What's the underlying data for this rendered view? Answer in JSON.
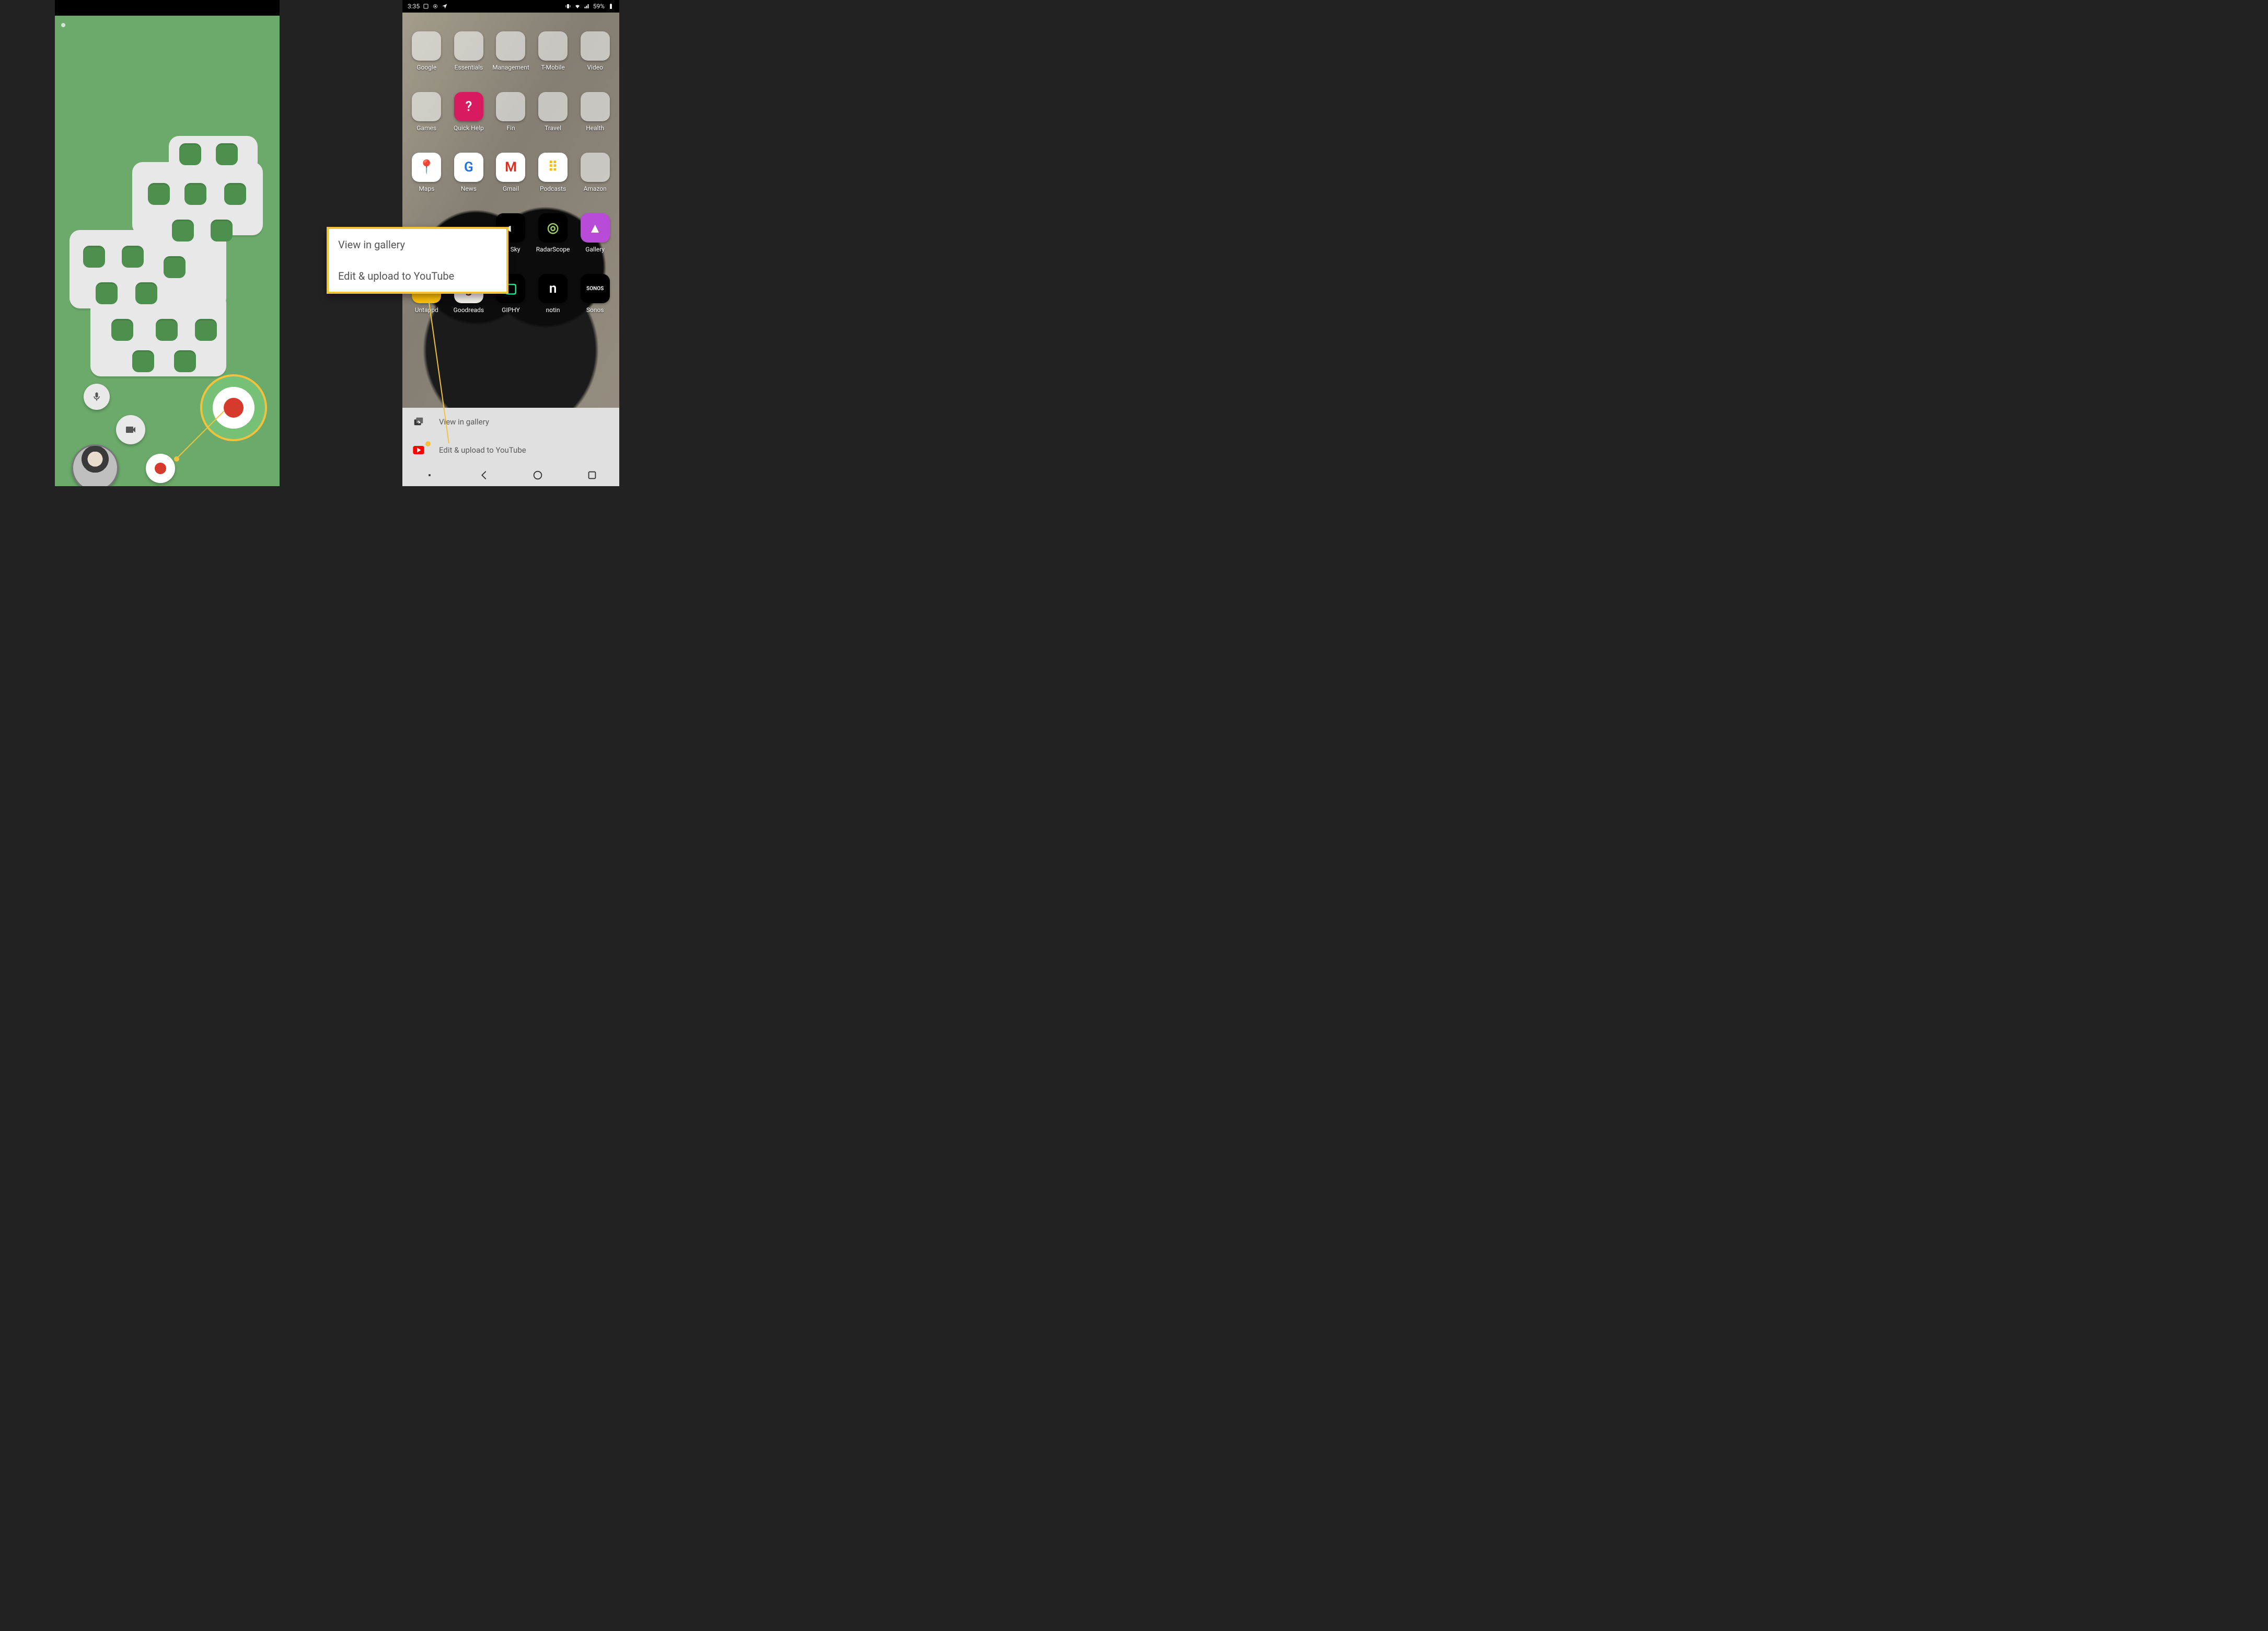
{
  "left": {
    "controls": {
      "mic_icon": "mic",
      "camera_icon": "video-camera",
      "record_icon": "record",
      "record_large_icon": "record",
      "avatar": "front-camera-preview"
    }
  },
  "right": {
    "statusbar": {
      "time": "3:35",
      "battery": "59%",
      "icons_left": [
        "screenshot",
        "cast",
        "gps"
      ],
      "icons_right": [
        "vibrate",
        "wifi",
        "signal",
        "battery"
      ]
    },
    "home_rows": [
      [
        {
          "label": "Google",
          "type": "folder",
          "colors": [
            "#ea4335",
            "#4285f4",
            "#fbbc05",
            "#34a853",
            "#f28b00",
            "#0f9d58",
            "#4285f4",
            "#ea4335",
            "#34a853"
          ]
        },
        {
          "label": "Essentials",
          "type": "folder",
          "colors": [
            "#8ab4f8",
            "#f28b82",
            "#fdd663",
            "#81c995",
            "#c58af9",
            "#78d9ec",
            "#a7c957",
            "#f6a96c",
            "#e7e7e7"
          ]
        },
        {
          "label": "Management",
          "type": "folder",
          "colors": [
            "#00b8d4",
            "#ffb300",
            "#7cb342",
            "#e53935",
            "#5e35b1",
            "#039be5",
            "#fdd835",
            "#8d6e63",
            "#90a4ae"
          ]
        },
        {
          "label": "T-Mobile",
          "type": "folder",
          "colors": [
            "#e20074",
            "#e20074",
            "#ffffff",
            "#e20074",
            "#ffffff",
            "#e20074",
            "#ffffff",
            "#e20074",
            "#e20074"
          ]
        },
        {
          "label": "Video",
          "type": "folder",
          "colors": [
            "#ff5555",
            "#00e1ff",
            "#222222",
            "#e50914",
            "#00a8e1",
            "#ffcc00",
            "#5cdb5c",
            "#ffffff",
            "#b4b4b4"
          ]
        }
      ],
      [
        {
          "label": "Games",
          "type": "folder",
          "colors": [
            "#f36f21",
            "#ffd000",
            "#00a3e0",
            "#7cbb00",
            "#e91e63",
            "#9c27b0",
            "#795548",
            "#607d8b",
            "#cddc39"
          ]
        },
        {
          "label": "Quick Help",
          "type": "icon",
          "bg": "#d81b60",
          "glyph": "?",
          "fg": "#fff"
        },
        {
          "label": "Fin",
          "type": "folder",
          "colors": [
            "#00796b",
            "#1565c0",
            "#ffb300",
            "#43a047",
            "#5e35b1",
            "#0288d1",
            "#c62828",
            "#6d4c41",
            "#9e9e9e"
          ]
        },
        {
          "label": "Travel",
          "type": "folder",
          "colors": [
            "#ff5a5f",
            "#00bfa5",
            "#ffab00",
            "#1e88e5",
            "#7b1fa2",
            "#43a047",
            "#fb8c00",
            "#546e7a",
            "#d4e157"
          ]
        },
        {
          "label": "Health",
          "type": "folder",
          "colors": [
            "#00bcd4",
            "#4caf50",
            "#ff9800",
            "#e91e63",
            "#3f51b5",
            "#009688",
            "#cddc39",
            "#795548",
            "#9e9e9e"
          ]
        }
      ],
      [
        {
          "label": "Maps",
          "type": "icon",
          "bg": "#ffffff",
          "glyph": "📍",
          "fg": "#d93025"
        },
        {
          "label": "News",
          "type": "icon",
          "bg": "#ffffff",
          "glyph": "G",
          "fg": "#1a73e8"
        },
        {
          "label": "Gmail",
          "type": "icon",
          "bg": "#ffffff",
          "glyph": "M",
          "fg": "#d93025"
        },
        {
          "label": "Podcasts",
          "type": "icon",
          "bg": "#ffffff",
          "glyph": "⠿",
          "fg": "#fbbc05"
        },
        {
          "label": "Amazon",
          "type": "folder",
          "colors": [
            "#232f3e",
            "#ff9900",
            "#146eb4",
            "#ffffff",
            "#232f3e",
            "#ff9900",
            "#146eb4",
            "#ffffff",
            "#232f3e"
          ]
        }
      ],
      [
        {
          "label": "",
          "type": "blank"
        },
        {
          "label": "",
          "type": "blank"
        },
        {
          "label": "…k Sky",
          "type": "icon",
          "bg": "#000000",
          "glyph": "◐",
          "fg": "#ffffff"
        },
        {
          "label": "RadarScope",
          "type": "icon",
          "bg": "#000000",
          "glyph": "◎",
          "fg": "#9ccc65"
        },
        {
          "label": "Gallery",
          "type": "icon",
          "bg": "#b84bd8",
          "glyph": "▲",
          "fg": "#ffffff"
        }
      ],
      [
        {
          "label": "Untappd",
          "type": "icon",
          "bg": "#ffc107",
          "glyph": "✖",
          "fg": "#5d4037"
        },
        {
          "label": "Goodreads",
          "type": "icon",
          "bg": "#f4f1ea",
          "glyph": "g",
          "fg": "#553b08"
        },
        {
          "label": "GIPHY",
          "type": "icon",
          "bg": "#000000",
          "glyph": "▢",
          "fg": "#00ff99"
        },
        {
          "label": "notin",
          "type": "icon",
          "bg": "#000000",
          "glyph": "n",
          "fg": "#ffffff"
        },
        {
          "label": "Sonos",
          "type": "icon",
          "bg": "#000000",
          "glyph": "SONOS",
          "fg": "#ffffff",
          "small": true
        }
      ]
    ],
    "sheet": {
      "items": [
        {
          "icon": "gallery",
          "label": "View in gallery"
        },
        {
          "icon": "youtube",
          "label": "Edit & upload to YouTube"
        }
      ]
    },
    "nav": [
      "dot",
      "back",
      "home",
      "recent"
    ]
  },
  "callout": {
    "option1": "View in gallery",
    "option2": "Edit & upload to YouTube"
  }
}
